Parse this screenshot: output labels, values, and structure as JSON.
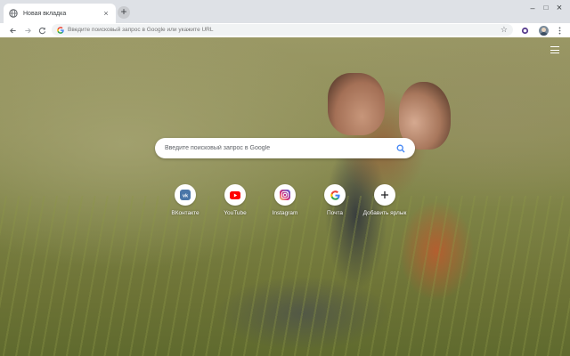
{
  "browser": {
    "tab": {
      "title": "Новая вкладка"
    },
    "new_tab_label": "+",
    "window_controls": {
      "minimize": "–",
      "maximize": "□",
      "close": "×"
    },
    "omnibox": {
      "placeholder": "Введите поисковый запрос в Google или укажите URL"
    },
    "icons": [
      "back-icon",
      "forward-icon",
      "reload-icon",
      "google-g-icon",
      "star-icon",
      "extension-icon",
      "profile-avatar",
      "menu-dots-icon"
    ]
  },
  "newtab": {
    "search": {
      "placeholder": "Введите поисковый запрос в Google"
    },
    "shortcuts": [
      {
        "label": "ВКонтакте",
        "icon": "vk-icon",
        "color": "#4a76a8"
      },
      {
        "label": "YouTube",
        "icon": "youtube-icon",
        "color": "#ff0000"
      },
      {
        "label": "Instagram",
        "icon": "instagram-icon",
        "color": "#c13584"
      },
      {
        "label": "Почта",
        "icon": "google-icon",
        "color": "#4285f4"
      },
      {
        "label": "Добавить ярлык",
        "icon": "add-icon",
        "color": "#202124"
      }
    ],
    "background": "photo of couple sitting in tall grass"
  }
}
